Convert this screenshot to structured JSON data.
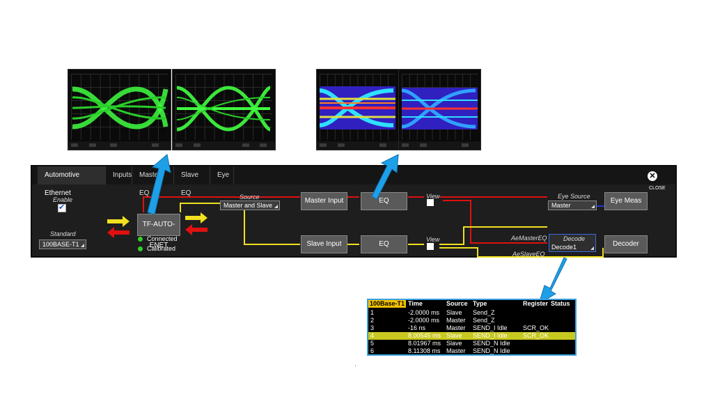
{
  "panel": {
    "tabs": [
      "Automotive Ethernet",
      "Inputs",
      "Master EQ",
      "Slave EQ",
      "Eye"
    ],
    "close_label": "CLOSE",
    "enable_label": "Enable",
    "standard_label": "Standard",
    "standard_value": "100BASE-T1",
    "probe_label": "TF-AUTO-ENET",
    "status_connected": "Connected",
    "status_calibrated": "Calibrated",
    "source_label": "Source",
    "source_value": "Master and Slave",
    "master_input": "Master Input",
    "slave_input": "Slave Input",
    "eq_label": "EQ",
    "view_label": "View",
    "eye_source_label": "Eye Source",
    "eye_source_value": "Master",
    "eye_meas": "Eye Meas",
    "decode_label": "Decode",
    "decode_value": "Decode1",
    "decoder": "Decoder",
    "ae_master_eq": "AeMasterEQ",
    "ae_slave_eq": "AeSlaveEQ"
  },
  "decode_table": {
    "headers": [
      "100Base-T1",
      "Time",
      "Source",
      "Type",
      "Register",
      "Status"
    ],
    "rows": [
      {
        "idx": "1",
        "time": "-2.0000 ms",
        "source": "Slave",
        "type": "Send_Z",
        "register": "",
        "highlight": false
      },
      {
        "idx": "2",
        "time": "-2.0000 ms",
        "source": "Master",
        "type": "Send_Z",
        "register": "",
        "highlight": false
      },
      {
        "idx": "3",
        "time": "-16 ns",
        "source": "Master",
        "type": "SEND_I Idle",
        "register": "SCR_OK",
        "highlight": false
      },
      {
        "idx": "4",
        "time": "8.00545 ms",
        "source": "Slave",
        "type": "SEND_I Idle",
        "register": "SCR_OK",
        "highlight": true
      },
      {
        "idx": "5",
        "time": "8.01967 ms",
        "source": "Slave",
        "type": "SEND_N Idle",
        "register": "",
        "highlight": false
      },
      {
        "idx": "6",
        "time": "8.11308 ms",
        "source": "Master",
        "type": "SEND_N Idle",
        "register": "",
        "highlight": false
      }
    ]
  },
  "colors": {
    "eye_green": "#40ff40",
    "wire_red": "#e01010",
    "wire_yellow": "#f0e020",
    "callout_blue": "#1ea0e8",
    "row_highlight": "#c8c820",
    "header_gold": "#f0c000"
  }
}
